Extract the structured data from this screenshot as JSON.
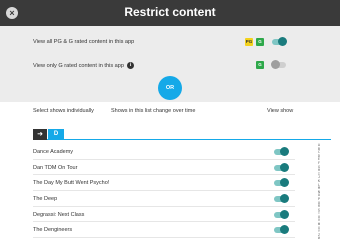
{
  "header": {
    "title": "Restrict content",
    "close_icon": "×"
  },
  "options": [
    {
      "label": "View all PG & G rated content in this app",
      "ratings": [
        "PG",
        "G"
      ],
      "enabled": true
    },
    {
      "label": "View only G rated content in this app",
      "ratings": [
        "G"
      ],
      "enabled": false
    }
  ],
  "or_label": "OR",
  "selection": {
    "label": "Select shows individually",
    "note": "Shows in this list change over time",
    "view_label": "View show"
  },
  "letter_nav": {
    "arrow": "➜",
    "current": "D"
  },
  "shows": [
    {
      "name": "Dance Academy",
      "enabled": true
    },
    {
      "name": "Dan TDM On Tour",
      "enabled": true
    },
    {
      "name": "The Day My Butt Went Psycho!",
      "enabled": true
    },
    {
      "name": "The Deep",
      "enabled": true
    },
    {
      "name": "Degrassi: Next Class",
      "enabled": true
    },
    {
      "name": "The Dengineers",
      "enabled": true
    }
  ],
  "alphabet": [
    "A",
    "B",
    "C",
    "D",
    "E",
    "F",
    "G",
    "H",
    "I",
    "J",
    "K",
    "L",
    "M",
    "N",
    "O",
    "P",
    "Q",
    "R",
    "S",
    "T",
    "U",
    "V",
    "W",
    "X",
    "Y",
    "Z",
    "#"
  ],
  "colors": {
    "header": "#3a3a3a",
    "accent": "#15a9e8",
    "toggle_on": "#1a7b7d",
    "pg_badge": "#f3d21b",
    "g_badge": "#2ea84a"
  }
}
